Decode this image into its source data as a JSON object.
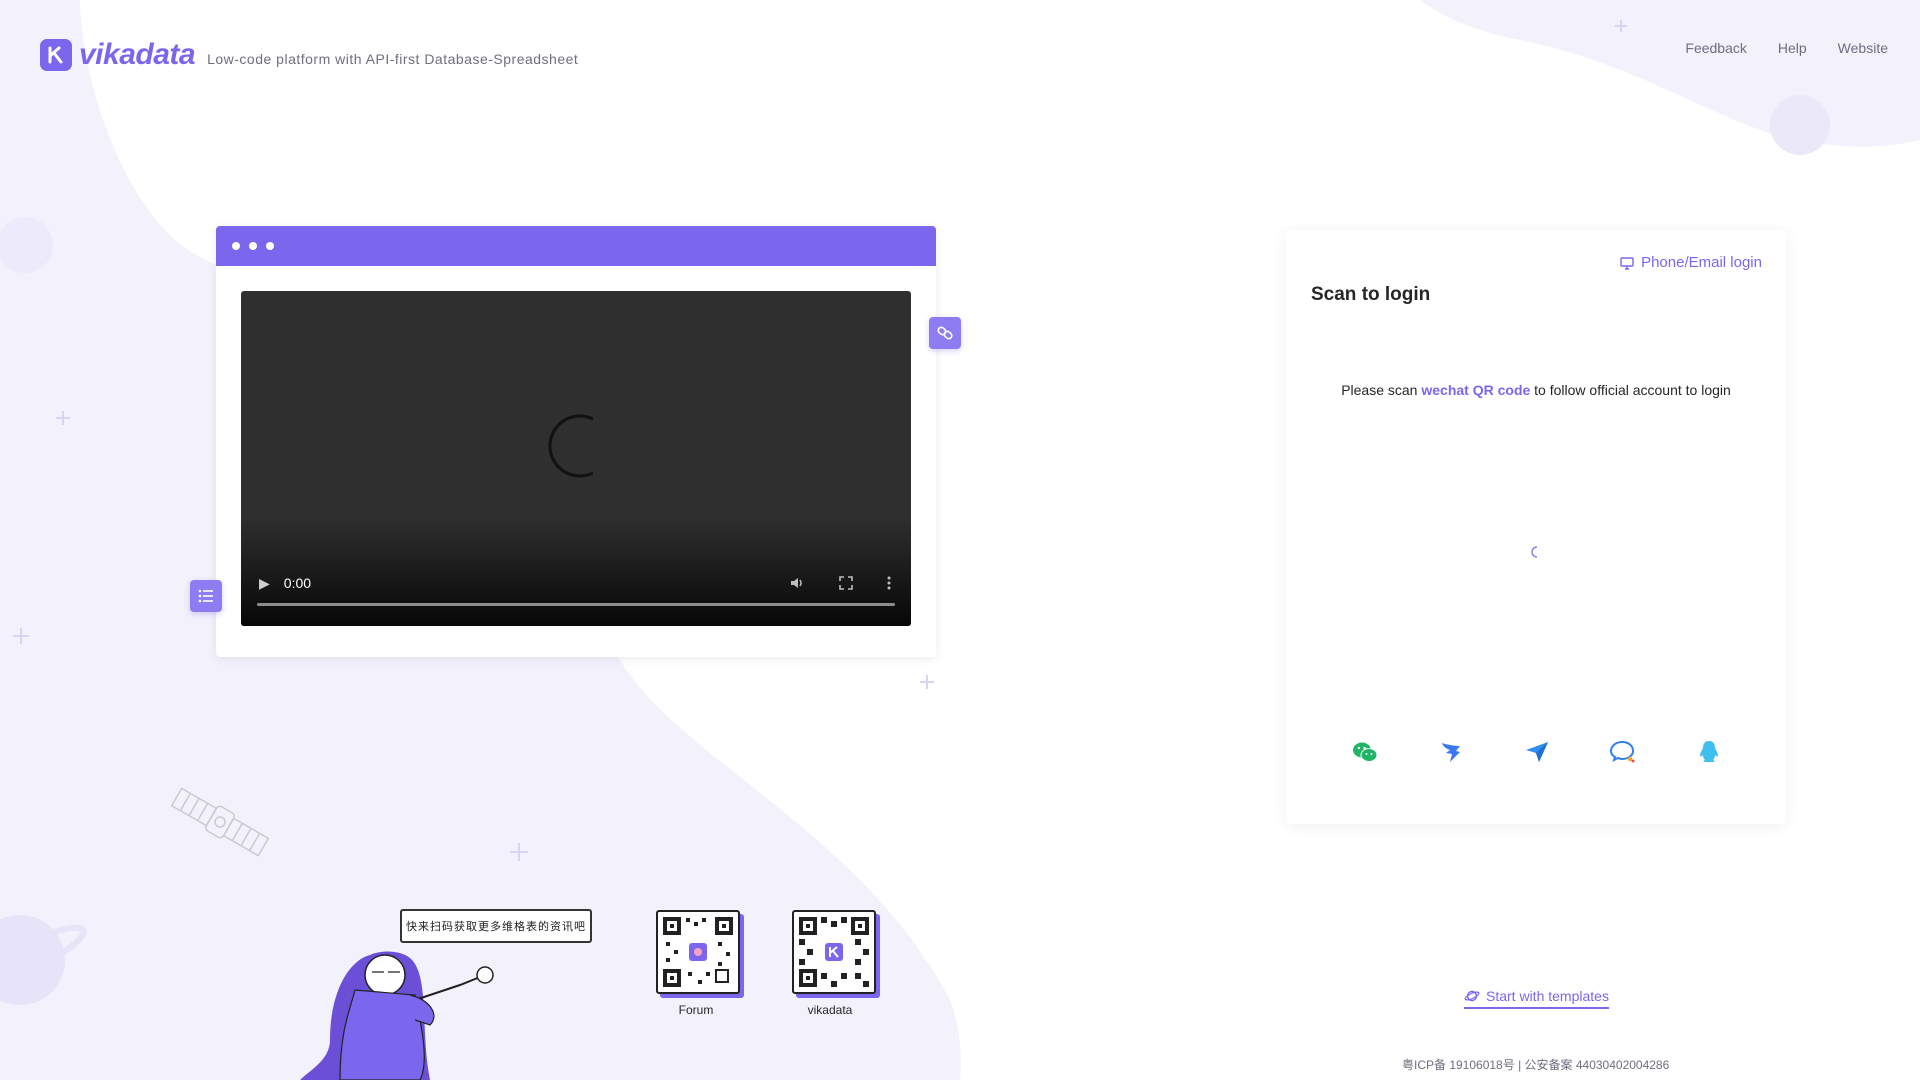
{
  "header": {
    "brand": "vikadata",
    "tagline": "Low-code platform with API-first Database-Spreadsheet",
    "nav": [
      {
        "label": "Feedback"
      },
      {
        "label": "Help"
      },
      {
        "label": "Website"
      }
    ]
  },
  "video": {
    "time": "0:00",
    "controls": [
      "play-icon",
      "volume-icon",
      "fullscreen-icon",
      "more-icon"
    ]
  },
  "login": {
    "switch_label": "Phone/Email login",
    "title": "Scan to login",
    "tip_prefix": "Please scan ",
    "tip_highlight": "wechat QR code",
    "tip_suffix": " to follow official account to login",
    "methods": [
      "wechat-icon",
      "dingtalk-icon",
      "feishu-icon",
      "wecom-icon",
      "qq-icon"
    ]
  },
  "footer": {
    "templates_label": "Start with templates",
    "icp": "粤ICP备 19106018号 | 公安备案 44030402004286"
  },
  "promo": {
    "bubble_text": "快来扫码获取更多维格表的资讯吧",
    "qr_codes": [
      {
        "label": "Forum"
      },
      {
        "label": "vikadata"
      }
    ]
  },
  "colors": {
    "brand": "#7b67ee",
    "background_blob": "#f3f1fc"
  }
}
